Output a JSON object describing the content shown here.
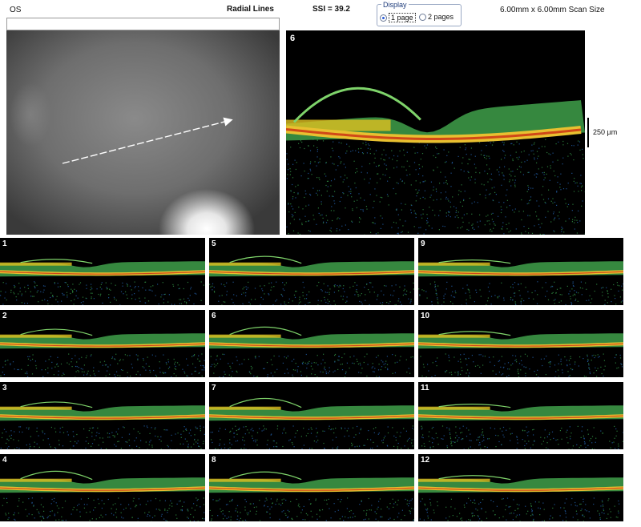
{
  "header": {
    "eye": "OS",
    "scan_type": "Radial Lines",
    "ssi": "SSI = 39.2",
    "scan_size": "6.00mm x 6.00mm Scan Size"
  },
  "display": {
    "legend": "Display",
    "options": [
      {
        "label": "1 page",
        "selected": true
      },
      {
        "label": "2 pages",
        "selected": false
      }
    ]
  },
  "main_scan": {
    "number": "6"
  },
  "scale_label": "250 µm",
  "thumbnails": [
    {
      "number": "1",
      "cyst": 0.3
    },
    {
      "number": "5",
      "cyst": 0.7
    },
    {
      "number": "9",
      "cyst": 0.2
    },
    {
      "number": "2",
      "cyst": 0.6
    },
    {
      "number": "6",
      "cyst": 0.9
    },
    {
      "number": "10",
      "cyst": 0.3
    },
    {
      "number": "3",
      "cyst": 0.5
    },
    {
      "number": "7",
      "cyst": 1.0
    },
    {
      "number": "11",
      "cyst": 0.2
    },
    {
      "number": "4",
      "cyst": 0.9
    },
    {
      "number": "8",
      "cyst": 0.8
    },
    {
      "number": "12",
      "cyst": 0.3
    }
  ]
}
